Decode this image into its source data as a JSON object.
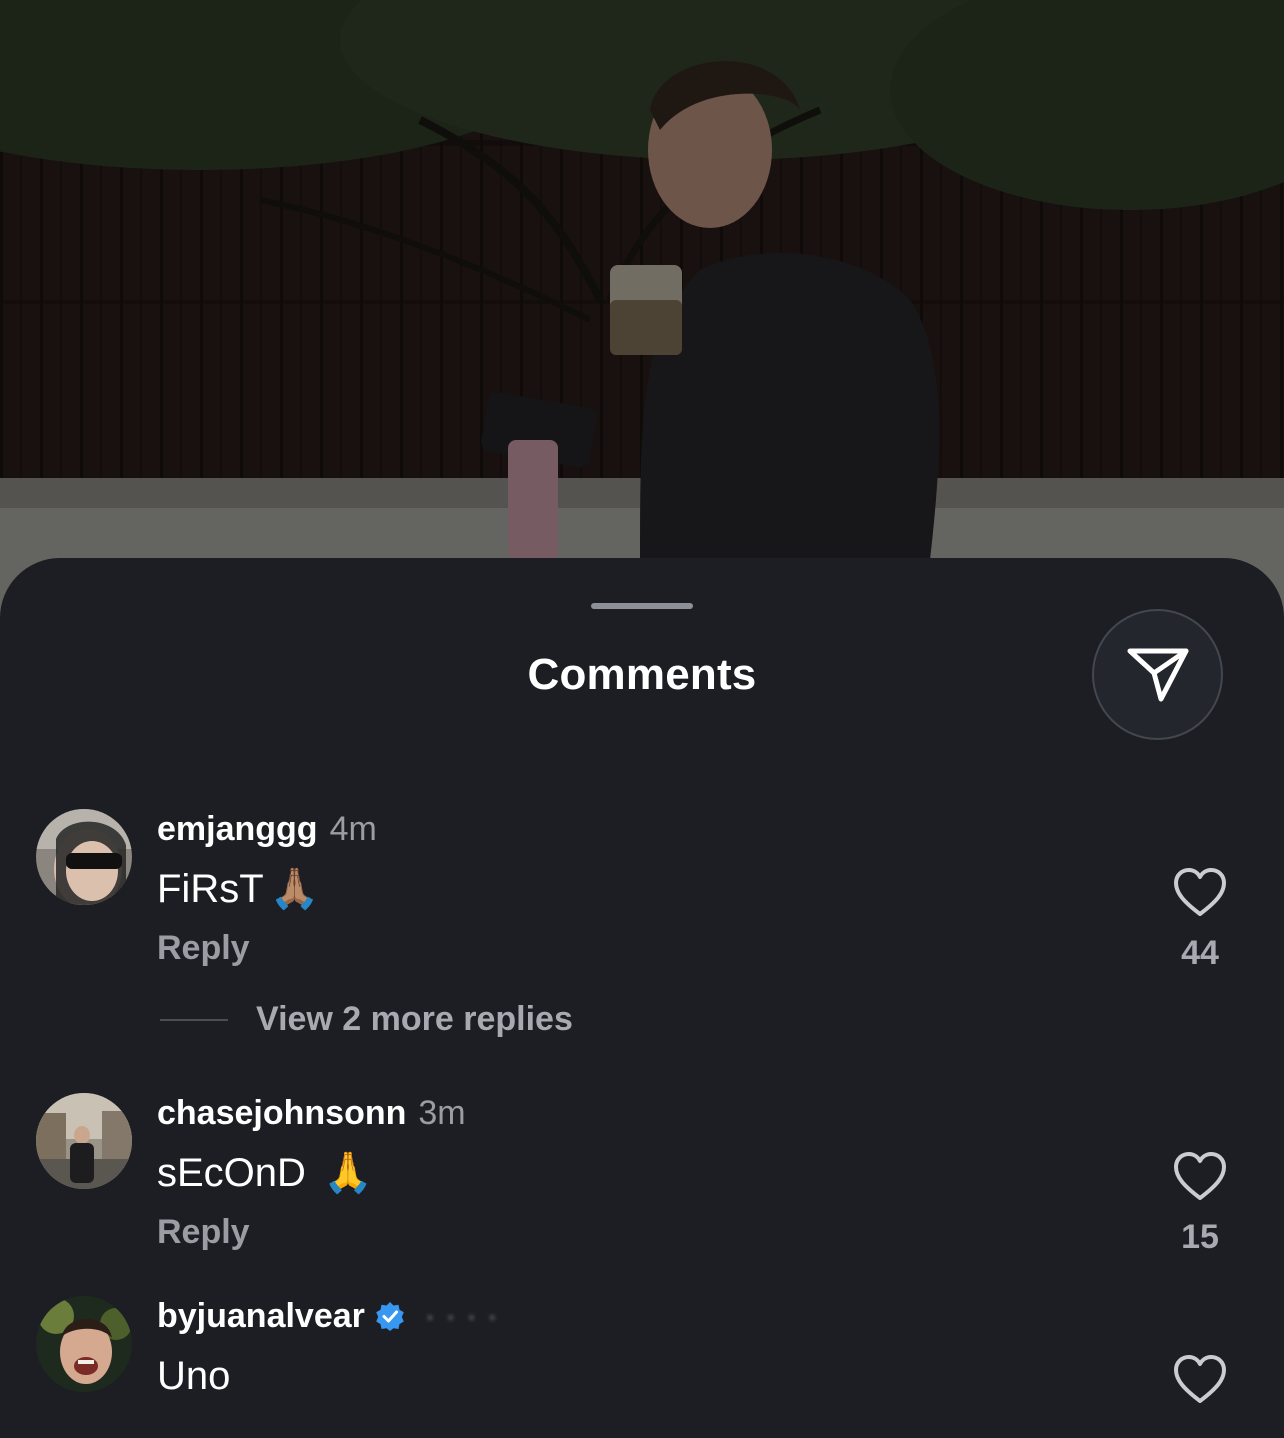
{
  "sheet": {
    "title": "Comments"
  },
  "icons": {
    "share": "paper-plane-icon",
    "like": "heart-outline-icon",
    "verified": "verified-badge-icon"
  },
  "colors": {
    "sheet_bg": "#1c1e23",
    "verified_blue": "#3897f0",
    "muted_text": "#9a9da3"
  },
  "comments": [
    {
      "username": "emjanggg",
      "time": "4m",
      "text": "FiRsT",
      "emoji": "🙏🏽",
      "reply_label": "Reply",
      "likes": "44"
    },
    {
      "username": "chasejohnsonn",
      "time": "3m",
      "text": "sEcOnD",
      "emoji": "🙏",
      "reply_label": "Reply",
      "likes": "15"
    },
    {
      "username": "byjuanalvear",
      "verified": true,
      "text": "Uno"
    }
  ],
  "view_replies": "View 2 more replies"
}
